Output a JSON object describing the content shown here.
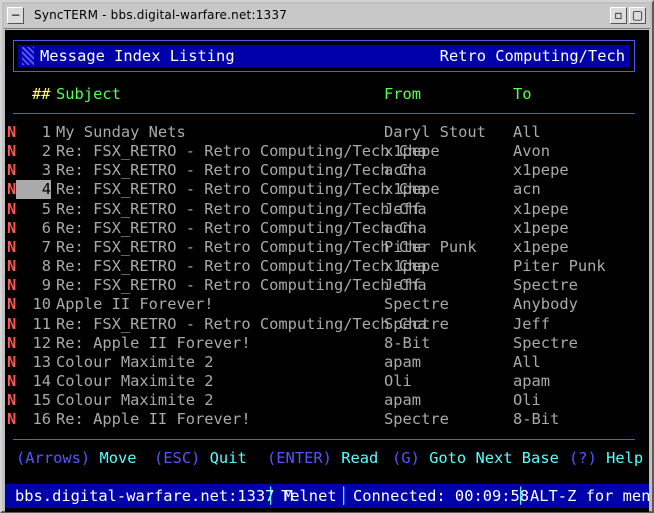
{
  "window": {
    "title": "SyncTERM - bbs.digital-warfare.net:1337",
    "menu_icon": "window-menu-icon",
    "minimize_icon": "minimize-icon",
    "maximize_icon": "maximize-icon"
  },
  "header": {
    "title": "Message Index Listing",
    "area": "Retro Computing/Tech"
  },
  "columns": {
    "num": "##",
    "subject": "Subject",
    "from": "From",
    "to": "To"
  },
  "messages": [
    {
      "flag": "N",
      "num": "1",
      "subject": "My Sunday Nets",
      "from": "Daryl Stout",
      "to": "All"
    },
    {
      "flag": "N",
      "num": "2",
      "subject": "Re: FSX_RETRO - Retro Computing/Tech Cha",
      "from": "x1pepe",
      "to": "Avon"
    },
    {
      "flag": "N",
      "num": "3",
      "subject": "Re: FSX_RETRO - Retro Computing/Tech Cha",
      "from": "acn",
      "to": "x1pepe"
    },
    {
      "flag": "N",
      "num": "4",
      "subject": "Re: FSX_RETRO - Retro Computing/Tech Cha",
      "from": "x1pepe",
      "to": "acn"
    },
    {
      "flag": "N",
      "num": "5",
      "subject": "Re: FSX_RETRO - Retro Computing/Tech Cha",
      "from": "Jeff",
      "to": "x1pepe"
    },
    {
      "flag": "N",
      "num": "6",
      "subject": "Re: FSX_RETRO - Retro Computing/Tech Cha",
      "from": "acn",
      "to": "x1pepe"
    },
    {
      "flag": "N",
      "num": "7",
      "subject": "Re: FSX_RETRO - Retro Computing/Tech Cha",
      "from": "Piter Punk",
      "to": "x1pepe"
    },
    {
      "flag": "N",
      "num": "8",
      "subject": "Re: FSX_RETRO - Retro Computing/Tech Cha",
      "from": "x1pepe",
      "to": "Piter Punk"
    },
    {
      "flag": "N",
      "num": "9",
      "subject": "Re: FSX_RETRO - Retro Computing/Tech Cha",
      "from": "Jeff",
      "to": "Spectre"
    },
    {
      "flag": "N",
      "num": "10",
      "subject": "Apple II Forever!",
      "from": "Spectre",
      "to": "Anybody"
    },
    {
      "flag": "N",
      "num": "11",
      "subject": "Re: FSX_RETRO - Retro Computing/Tech Cha",
      "from": "Spectre",
      "to": "Jeff"
    },
    {
      "flag": "N",
      "num": "12",
      "subject": "Re: Apple II Forever!",
      "from": "8-Bit",
      "to": "Spectre"
    },
    {
      "flag": "N",
      "num": "13",
      "subject": "Colour Maximite 2",
      "from": "apam",
      "to": "All"
    },
    {
      "flag": "N",
      "num": "14",
      "subject": "Colour Maximite 2",
      "from": "Oli",
      "to": "apam"
    },
    {
      "flag": "N",
      "num": "15",
      "subject": "Colour Maximite 2",
      "from": "apam",
      "to": "Oli"
    },
    {
      "flag": "N",
      "num": "16",
      "subject": "Re: Apple II Forever!",
      "from": "Spectre",
      "to": "8-Bit"
    }
  ],
  "selected_index": 3,
  "help": {
    "arrows_key": "Arrows",
    "arrows_action": "Move",
    "esc_key": "ESC",
    "esc_action": "Quit",
    "enter_key": "ENTER",
    "enter_action": "Read",
    "g_key": "G",
    "g_action": "Goto Next Base",
    "q_key": "?",
    "q_action": "Help"
  },
  "status": {
    "host": "bbs.digital-warfare.net:1337 M",
    "protocol": "Telnet",
    "connected": "Connected: 00:09:58",
    "menu_hint": "ALT-Z for menu"
  },
  "colors": {
    "background": "#000000",
    "header_bar": "#0000aa",
    "accent_green": "#55ff55",
    "new_flag_red": "#ff5555",
    "text_gray": "#aaaaaa",
    "divider_blue": "#5555ff"
  }
}
